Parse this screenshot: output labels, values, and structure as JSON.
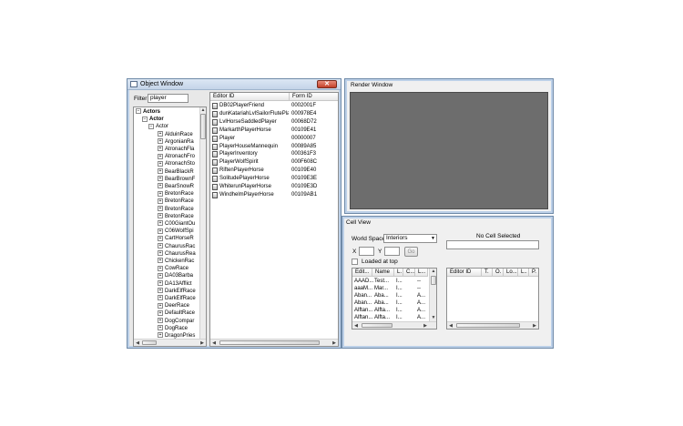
{
  "object_window": {
    "title": "Object Window",
    "close_glyph": "✕",
    "filter_label": "Filter",
    "filter_value": "player",
    "tree": [
      {
        "label": "Actors",
        "level": 0,
        "expander": "−",
        "bold": true
      },
      {
        "label": "Actor",
        "level": 1,
        "expander": "−",
        "bold": true
      },
      {
        "label": "Actor",
        "level": 2,
        "expander": "−",
        "bold": false
      },
      {
        "label": "AlduinRace",
        "level": 3,
        "expander": "+"
      },
      {
        "label": "ArgonianRa",
        "level": 3,
        "expander": "+"
      },
      {
        "label": "AtronachFla",
        "level": 3,
        "expander": "+"
      },
      {
        "label": "AtronachFro",
        "level": 3,
        "expander": "+"
      },
      {
        "label": "AtronachSto",
        "level": 3,
        "expander": "+"
      },
      {
        "label": "BearBlackR",
        "level": 3,
        "expander": "+"
      },
      {
        "label": "BearBrownF",
        "level": 3,
        "expander": "+"
      },
      {
        "label": "BearSnowR",
        "level": 3,
        "expander": "+"
      },
      {
        "label": "BretonRace",
        "level": 3,
        "expander": "+"
      },
      {
        "label": "BretonRace",
        "level": 3,
        "expander": "+"
      },
      {
        "label": "BretonRace",
        "level": 3,
        "expander": "+"
      },
      {
        "label": "BretonRace",
        "level": 3,
        "expander": "+"
      },
      {
        "label": "C00GiantOu",
        "level": 3,
        "expander": "+"
      },
      {
        "label": "C06WolfSpi",
        "level": 3,
        "expander": "+"
      },
      {
        "label": "CartHorseR",
        "level": 3,
        "expander": "+"
      },
      {
        "label": "ChaurusRac",
        "level": 3,
        "expander": "+"
      },
      {
        "label": "ChaurusRea",
        "level": 3,
        "expander": "+"
      },
      {
        "label": "ChickenRac",
        "level": 3,
        "expander": "+"
      },
      {
        "label": "CowRace",
        "level": 3,
        "expander": "+"
      },
      {
        "label": "DA03Barba",
        "level": 3,
        "expander": "+"
      },
      {
        "label": "DA13Afflict",
        "level": 3,
        "expander": "+"
      },
      {
        "label": "DarkElfRace",
        "level": 3,
        "expander": "+"
      },
      {
        "label": "DarkElfRace",
        "level": 3,
        "expander": "+"
      },
      {
        "label": "DeerRace",
        "level": 3,
        "expander": "+"
      },
      {
        "label": "DefaultRace",
        "level": 3,
        "expander": "+"
      },
      {
        "label": "DogCompar",
        "level": 3,
        "expander": "+"
      },
      {
        "label": "DogRace",
        "level": 3,
        "expander": "+"
      },
      {
        "label": "DragonPries",
        "level": 3,
        "expander": "+"
      }
    ],
    "list_headers": [
      "Editor ID",
      "Form ID"
    ],
    "list_rows": [
      {
        "editor_id": "DB02PlayerFriend",
        "form_id": "0002001F"
      },
      {
        "editor_id": "dunKatariahLvlSailorFlutePla...",
        "form_id": "000978E4"
      },
      {
        "editor_id": "LvlHorseSaddledPlayer",
        "form_id": "00068D72"
      },
      {
        "editor_id": "MarkarthPlayerHorse",
        "form_id": "00109E41"
      },
      {
        "editor_id": "Player",
        "form_id": "00000007"
      },
      {
        "editor_id": "PlayerHouseMannequin",
        "form_id": "00089A85"
      },
      {
        "editor_id": "PlayerInventory",
        "form_id": "000361F3"
      },
      {
        "editor_id": "PlayerWolfSpirit",
        "form_id": "000F608C"
      },
      {
        "editor_id": "RiftenPlayerHorse",
        "form_id": "00109E40"
      },
      {
        "editor_id": "SolitudePlayerHorse",
        "form_id": "00109E3E"
      },
      {
        "editor_id": "WhiterunPlayerHorse",
        "form_id": "00109E3D"
      },
      {
        "editor_id": "WindhelmPlayerHorse",
        "form_id": "00109AB1"
      }
    ]
  },
  "render_window": {
    "title": "Render Window",
    "viewport_color": "#6d6d6d"
  },
  "cell_view": {
    "title": "Cell View",
    "world_space_label": "World Space",
    "world_space_value": "Interiors",
    "x_label": "X",
    "y_label": "Y",
    "go_label": "Go",
    "loaded_at_top_label": "Loaded at top",
    "no_cell_selected": "No Cell Selected",
    "cell_list_headers": [
      "Edit...",
      "Name",
      "L.",
      "C...",
      "L..."
    ],
    "cell_list_rows": [
      [
        "AAAD...",
        "Test...",
        "I...",
        "",
        "--"
      ],
      [
        "aaaM...",
        "Mar...",
        "I...",
        "",
        "--"
      ],
      [
        "Aban...",
        "Aba...",
        "I...",
        "",
        "A..."
      ],
      [
        "Aban...",
        "Aba...",
        "I...",
        "",
        "A..."
      ],
      [
        "Alftan...",
        "Alfta...",
        "I...",
        "",
        "A..."
      ],
      [
        "Alftan...",
        "Alfta...",
        "I...",
        "",
        "A..."
      ]
    ],
    "object_list_headers": [
      "Editor ID",
      "T.",
      "O.",
      "Lo...",
      "L..",
      "P."
    ]
  },
  "icons": {
    "title_icon": "window-icon",
    "row_icon": "npc-record-icon",
    "dropdown": "chevron-down-icon"
  }
}
